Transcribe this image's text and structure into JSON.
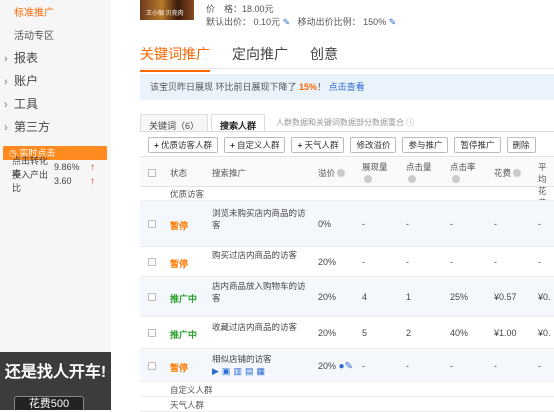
{
  "sidebar": {
    "active_item": "标准推广",
    "sub_item": "活动专区",
    "categories": [
      {
        "label": "报表"
      },
      {
        "label": "账户"
      },
      {
        "label": "工具"
      },
      {
        "label": "第三方"
      }
    ],
    "realtime": {
      "title": "实时点击",
      "rows": [
        {
          "label": "点击转化率",
          "value": "9.86%"
        },
        {
          "label": "投入产出比",
          "value": "3.60"
        }
      ]
    },
    "promo": {
      "slogan": "还是找人开车!",
      "fee": "花费500"
    }
  },
  "item": {
    "thumb_text": "王小咖 贝壳肉",
    "price_label": "价　格：",
    "price": "18.00元",
    "default_bid_label": "默认出价：",
    "default_bid": "0.10元",
    "mobile_ratio_label": "移动出价比例：",
    "mobile_ratio": "150%"
  },
  "main_tabs": [
    {
      "label": "关键词推广",
      "active": true
    },
    {
      "label": "定向推广",
      "active": false
    },
    {
      "label": "创意",
      "active": false
    }
  ],
  "notice": {
    "text_before": "该宝贝昨日展现 环比前日展现下降了",
    "percent": "15%",
    "text_after": "！",
    "link": "点击查看"
  },
  "sub_tabs": [
    {
      "label": "关键词（6）",
      "active": false
    },
    {
      "label": "搜索人群",
      "active": true
    }
  ],
  "sub_note": "人群数据和关键词数据部分数据重合 ⓘ",
  "toolbar": {
    "buttons": [
      {
        "label": "优质访客人群",
        "plus": true
      },
      {
        "label": "自定义人群",
        "plus": true
      },
      {
        "label": "天气人群",
        "plus": true
      },
      {
        "label": "修改溢价",
        "plus": false
      },
      {
        "label": "参与推广",
        "plus": false
      },
      {
        "label": "暂停推广",
        "plus": false
      },
      {
        "label": "删除",
        "plus": false
      }
    ]
  },
  "table": {
    "headers": {
      "status": "状态",
      "crowd": "搜索推广",
      "premium": "溢价",
      "impressions": "展现量",
      "clicks": "点击量",
      "ctr": "点击率",
      "cost": "花费",
      "avg_line1": "平均",
      "avg_line2": "花费"
    },
    "groups": {
      "quality": "优质访客",
      "custom": "自定义人群",
      "weather": "天气人群"
    },
    "rows": [
      {
        "status": "暂停",
        "status_type": "pause",
        "crowd": "浏览未购买店内商品的访客",
        "premium": "0%",
        "impressions": "-",
        "clicks": "-",
        "ctr": "-",
        "cost": "-",
        "avg": "-"
      },
      {
        "status": "暂停",
        "status_type": "pause",
        "crowd": "购买过店内商品的访客",
        "premium": "20%",
        "impressions": "-",
        "clicks": "-",
        "ctr": "-",
        "cost": "-",
        "avg": "-"
      },
      {
        "status": "推广中",
        "status_type": "run",
        "crowd": "店内商品放入购物车的访客",
        "premium": "20%",
        "impressions": "4",
        "clicks": "1",
        "ctr": "25%",
        "cost": "¥0.57",
        "avg": "¥0."
      },
      {
        "status": "推广中",
        "status_type": "run",
        "crowd": "收藏过店内商品的访客",
        "premium": "20%",
        "impressions": "5",
        "clicks": "2",
        "ctr": "40%",
        "cost": "¥1.00",
        "avg": "¥0."
      },
      {
        "status": "暂停",
        "status_type": "pause",
        "crowd": "相似店铺的访客",
        "premium": "20%",
        "impressions": "-",
        "clicks": "-",
        "ctr": "-",
        "cost": "-",
        "avg": "-"
      }
    ]
  }
}
